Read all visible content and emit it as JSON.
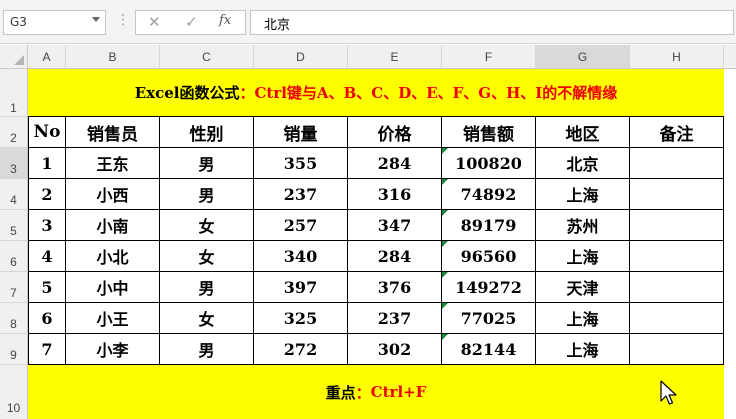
{
  "formula_bar": {
    "name_box": "G3",
    "cancel_icon": "✕",
    "enter_icon": "✓",
    "fx_label": "fx",
    "formula_value": "北京"
  },
  "columns": [
    "A",
    "B",
    "C",
    "D",
    "E",
    "F",
    "G",
    "H"
  ],
  "rows": [
    "1",
    "2",
    "3",
    "4",
    "5",
    "6",
    "7",
    "8",
    "9",
    "10"
  ],
  "title": {
    "prefix": "Excel函数公式",
    "separator": "：",
    "highlight": "Ctrl键与A、B、C、D、E、F、G、H、I的不解情缘"
  },
  "table": {
    "headers": [
      "No",
      "销售员",
      "性别",
      "销量",
      "价格",
      "销售额",
      "地区",
      "备注"
    ],
    "rows": [
      [
        "1",
        "王东",
        "男",
        "355",
        "284",
        "100820",
        "北京",
        ""
      ],
      [
        "2",
        "小西",
        "男",
        "237",
        "316",
        "74892",
        "上海",
        ""
      ],
      [
        "3",
        "小南",
        "女",
        "257",
        "347",
        "89179",
        "苏州",
        ""
      ],
      [
        "4",
        "小北",
        "女",
        "340",
        "284",
        "96560",
        "上海",
        ""
      ],
      [
        "5",
        "小中",
        "男",
        "397",
        "376",
        "149272",
        "天津",
        ""
      ],
      [
        "6",
        "小王",
        "女",
        "325",
        "237",
        "77025",
        "上海",
        ""
      ],
      [
        "7",
        "小李",
        "男",
        "272",
        "302",
        "82144",
        "上海",
        ""
      ]
    ]
  },
  "footer": {
    "prefix": "重点",
    "separator": "：",
    "highlight": "Ctrl+F"
  },
  "colors": {
    "highlight_fill": "#ffff00",
    "accent_text": "#ee0000",
    "error_indicator": "#1d8a3a"
  },
  "icons": {
    "cancel": "close-icon",
    "enter": "check-icon",
    "function": "function-icon",
    "cursor": "mouse-pointer-icon"
  }
}
